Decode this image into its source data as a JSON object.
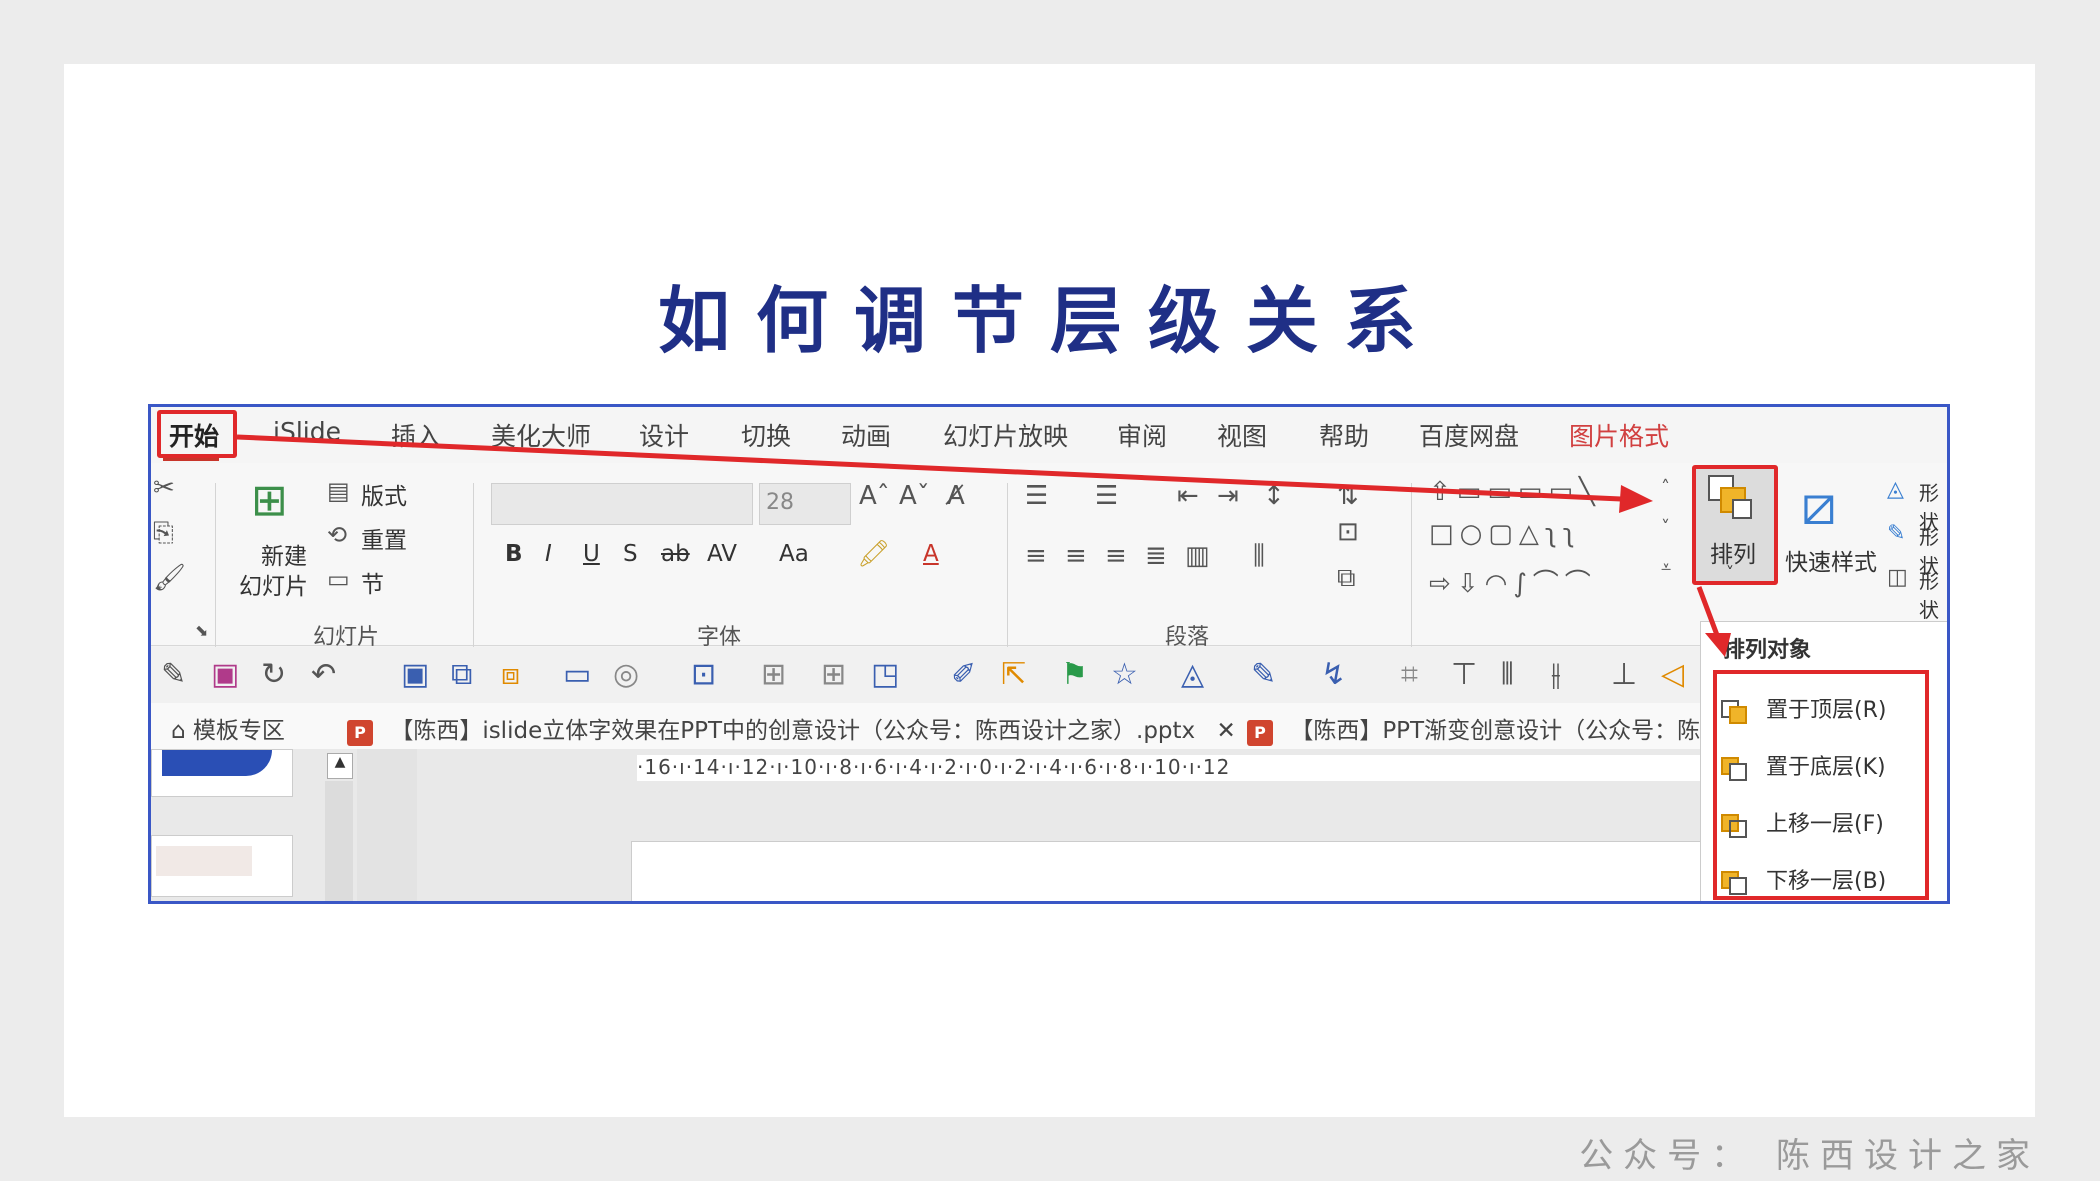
{
  "page": {
    "title": "如何调节层级关系",
    "footer": "公众号：  陈西设计之家"
  },
  "menu": {
    "tabs": [
      "开始",
      "iSlide",
      "插入",
      "美化大师",
      "设计",
      "切换",
      "动画",
      "幻灯片放映",
      "审阅",
      "视图",
      "帮助",
      "百度网盘",
      "图片格式"
    ]
  },
  "ribbon": {
    "slides_group": {
      "new_slide_line1": "新建",
      "new_slide_line2": "幻灯片",
      "layout": "版式",
      "reset": "重置",
      "section": "节",
      "label": "幻灯片"
    },
    "font_group": {
      "size_value": "28",
      "label": "字体",
      "bold": "B",
      "italic": "I",
      "underline": "U",
      "shadow": "S",
      "strike": "ab",
      "spacing": "AV",
      "case": "Aa",
      "font_color": "A"
    },
    "paragraph_group": {
      "label": "段落"
    },
    "arrange_button": "排列",
    "quick_styles": "快速样式",
    "shape_cmds": [
      "形状",
      "形状",
      "形状"
    ]
  },
  "dropdown": {
    "header": "排列对象",
    "items": [
      "置于顶层(R)",
      "置于底层(K)",
      "上移一层(F)",
      "下移一层(B)"
    ]
  },
  "doc_tabs": {
    "home": "模板专区",
    "tab1": "【陈西】islide立体字效果在PPT中的创意设计（公众号：陈西设计之家）.pptx",
    "tab2": "【陈西】PPT渐变创意设计（公众号：陈"
  },
  "ruler": {
    "text": "·16·ı·14·ı·12·ı·10·ı·8·ı·6·ı·4·ı·2·ı·0·ı·2·ı·4·ı·6·ı·8·ı·10·ı·12"
  },
  "colors": {
    "title": "#1f2f86",
    "highlight": "#e0282a",
    "accent_tab": "#d14040"
  }
}
